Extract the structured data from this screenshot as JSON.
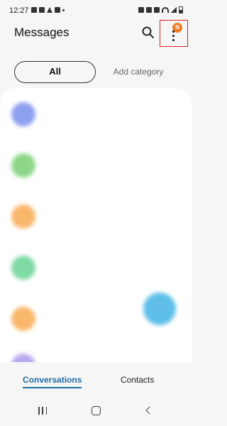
{
  "status_bar": {
    "time": "12:27",
    "left_icons": [
      "sim-icon",
      "photo-icon",
      "warning-icon",
      "image-icon",
      "dot-icon"
    ],
    "right_icons": [
      "vibrate-icon",
      "alarm-icon",
      "mute-icon",
      "wifi-icon",
      "signal-icon",
      "battery-icon"
    ]
  },
  "header": {
    "title": "Messages",
    "search_icon": "search-icon",
    "more_icon": "more-vert-icon",
    "badge": "N"
  },
  "filters": {
    "all_label": "All",
    "add_category_label": "Add category"
  },
  "conversations": [
    {
      "avatar_color": "#8ea0f0",
      "name": "",
      "preview": "",
      "time": ""
    },
    {
      "avatar_color": "#8fd68a",
      "name": "",
      "preview": "",
      "time": ""
    },
    {
      "avatar_color": "#f9b76b",
      "name": "",
      "preview": "",
      "time": ""
    },
    {
      "avatar_color": "#7fdaa5",
      "name": "",
      "preview": "",
      "time": ""
    },
    {
      "avatar_color": "#f9b76b",
      "name": "",
      "preview": "",
      "time": ""
    },
    {
      "avatar_color": "#b9a7f0",
      "name": "",
      "preview": "",
      "time": ""
    }
  ],
  "fab_color": "#5fbfe9",
  "bottom_tabs": {
    "conversations": "Conversations",
    "contacts": "Contacts"
  },
  "colors": {
    "accent": "#1f6ea3",
    "badge": "#f07b24",
    "highlight_box": "#dd2222"
  }
}
